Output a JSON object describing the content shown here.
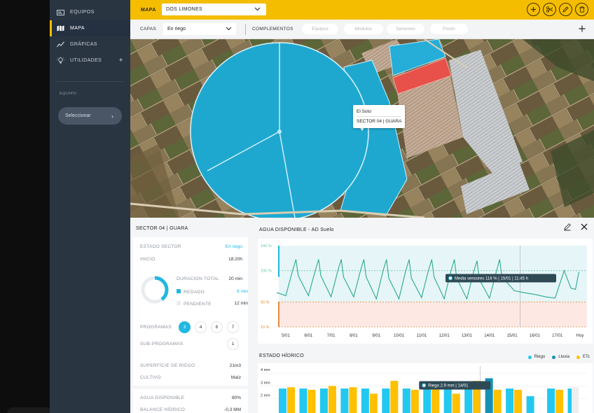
{
  "sidebar": {
    "items": [
      {
        "label": "EQUIPOS",
        "icon": "card-icon"
      },
      {
        "label": "MAPA",
        "icon": "map-icon"
      },
      {
        "label": "GRÁFICAS",
        "icon": "chart-line-icon"
      },
      {
        "label": "UTILIDADES",
        "icon": "bulb-icon",
        "plus": "+"
      }
    ],
    "equipo_label": "EQUIPO",
    "select_label": "Seleccionar"
  },
  "topbar": {
    "label": "MAPA",
    "farm": "DOS LIMONES"
  },
  "layers": {
    "capas_label": "CAPAS",
    "capas_value": "En riego",
    "complementos_label": "COMPLEMENTOS",
    "pills": [
      "Equipos",
      "Módulos",
      "Sensores",
      "Pivots"
    ]
  },
  "map": {
    "tooltip_name": "El Soto",
    "tooltip_sector": "SECTOR 04 | GUARA"
  },
  "sector": {
    "title": "SECTOR 04 | GUARA",
    "estado_label": "ESTADO SECTOR",
    "estado_value": "En riego",
    "inicio_label": "INICIO",
    "inicio_value": "18:20h",
    "duracion_label": "DURACION TOTAL",
    "duracion_value": "20 min",
    "regado_label": "REGADO",
    "regado_value": "8 min",
    "pendiente_label": "PENDIENTE",
    "pendiente_value": "12 min",
    "regado_fraction": 0.4,
    "programas_label": "PROGRAMAS",
    "programas": [
      "3",
      "4",
      "6",
      "7"
    ],
    "programa_selected": "3",
    "subprogramas_label": "SUB-PROGRAMAS",
    "subprogramas": [
      "1"
    ],
    "superficie_label": "SUPERFÍCIE DE RIEGO",
    "superficie_value": "21m3",
    "cultivo_label": "CULTIVO",
    "cultivo_value": "Maíz",
    "agua_label": "AGUA DISPONIBLE",
    "agua_value": "80%",
    "balance_label": "BALANCE HÍDRICO",
    "balance_value": "-0,3 MM"
  },
  "colors": {
    "accent": "#f5bd00",
    "sidebar": "#2a3542",
    "irrigation": "#20b8e0",
    "alert_red": "#e8504a",
    "riego": "#22c8ef",
    "lluvia": "#1591b8",
    "etc": "#ffc000"
  },
  "chart_data": [
    {
      "type": "line",
      "title": "AGUA DISPONIBLE - AD Suelo",
      "y_tick_labels": [
        "140 %",
        "100 %",
        "50 %",
        "10 %"
      ],
      "x_tick_labels": [
        "5/01",
        "6/01",
        "7/01",
        "8/01",
        "9/01",
        "10/01",
        "11/01",
        "12/01",
        "13/01",
        "14/01",
        "15/01",
        "16/01",
        "17/01",
        "Hoy"
      ],
      "ylim": [
        10,
        140
      ],
      "thresholds": [
        100,
        50,
        10
      ],
      "series": [
        {
          "name": "Media sensores",
          "x": [
            4.6,
            5.0,
            5.3,
            5.45,
            5.55,
            6.0,
            6.3,
            6.45,
            6.55,
            7.0,
            7.3,
            7.45,
            7.55,
            8.0,
            8.3,
            8.45,
            8.55,
            9.0,
            9.3,
            9.45,
            9.55,
            10.0,
            10.3,
            10.45,
            10.55,
            11.0,
            11.3,
            11.45,
            11.55,
            12.0,
            12.3,
            12.45,
            12.55,
            13.0,
            13.3,
            13.45,
            13.55,
            14.0,
            14.3,
            14.45,
            14.55,
            15.0,
            15.1,
            15.5,
            16.0,
            16.5,
            16.9,
            17.3,
            17.6,
            17.8,
            17.95
          ],
          "y": [
            65,
            60,
            100,
            118,
            92,
            60,
            100,
            118,
            92,
            58,
            100,
            118,
            90,
            58,
            100,
            118,
            90,
            55,
            100,
            118,
            88,
            55,
            100,
            118,
            88,
            57,
            100,
            118,
            90,
            55,
            100,
            118,
            88,
            55,
            98,
            116,
            86,
            56,
            98,
            118,
            90,
            72,
            68,
            65,
            62,
            58,
            56,
            100,
            72,
            70,
            98
          ]
        }
      ],
      "annotation": "Media sensores  118 %  |  15/01  |  11:45 h"
    },
    {
      "type": "bar",
      "title": "ESTADO HÍDRICO",
      "y_tick_labels": [
        "4 mm",
        "3 mm",
        "2 mm"
      ],
      "ylim": [
        1,
        4
      ],
      "series": [
        {
          "name": "Riego",
          "values": [
            2.8,
            2.8,
            2.8,
            2.8,
            2.8,
            2.8,
            2.8,
            2.9,
            2.8,
            2.8,
            2.8,
            2.8,
            2.2,
            2.8,
            2.8
          ]
        },
        {
          "name": "Lluvia",
          "values": [
            0,
            0,
            0,
            0,
            0,
            0,
            0,
            0,
            0,
            0,
            3.6,
            0,
            0,
            0,
            0
          ]
        },
        {
          "name": "ETc",
          "values": [
            2.9,
            2.7,
            3.0,
            2.9,
            2.4,
            3.4,
            2.7,
            2.8,
            2.4,
            3.4,
            2.7,
            2.7,
            0,
            2.7,
            0
          ]
        }
      ],
      "annotation": "Riego  2.9 mm  |  14/01"
    }
  ]
}
